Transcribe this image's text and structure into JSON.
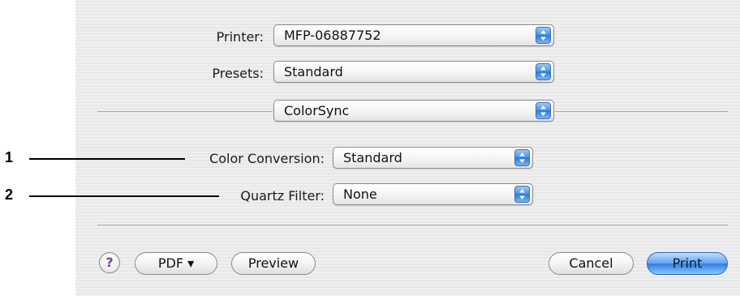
{
  "printer": {
    "label": "Printer:",
    "value": "MFP-06887752"
  },
  "presets": {
    "label": "Presets:",
    "value": "Standard"
  },
  "panel": {
    "value": "ColorSync"
  },
  "color_conversion": {
    "label": "Color Conversion:",
    "value": "Standard"
  },
  "quartz_filter": {
    "label": "Quartz Filter:",
    "value": "None"
  },
  "callouts": [
    "1",
    "2"
  ],
  "buttons": {
    "help": "?",
    "pdf": "PDF ▾",
    "preview": "Preview",
    "cancel": "Cancel",
    "print": "Print"
  },
  "colors": {
    "accent": "#3f8fe7",
    "default_button": "#5ea2f2"
  }
}
